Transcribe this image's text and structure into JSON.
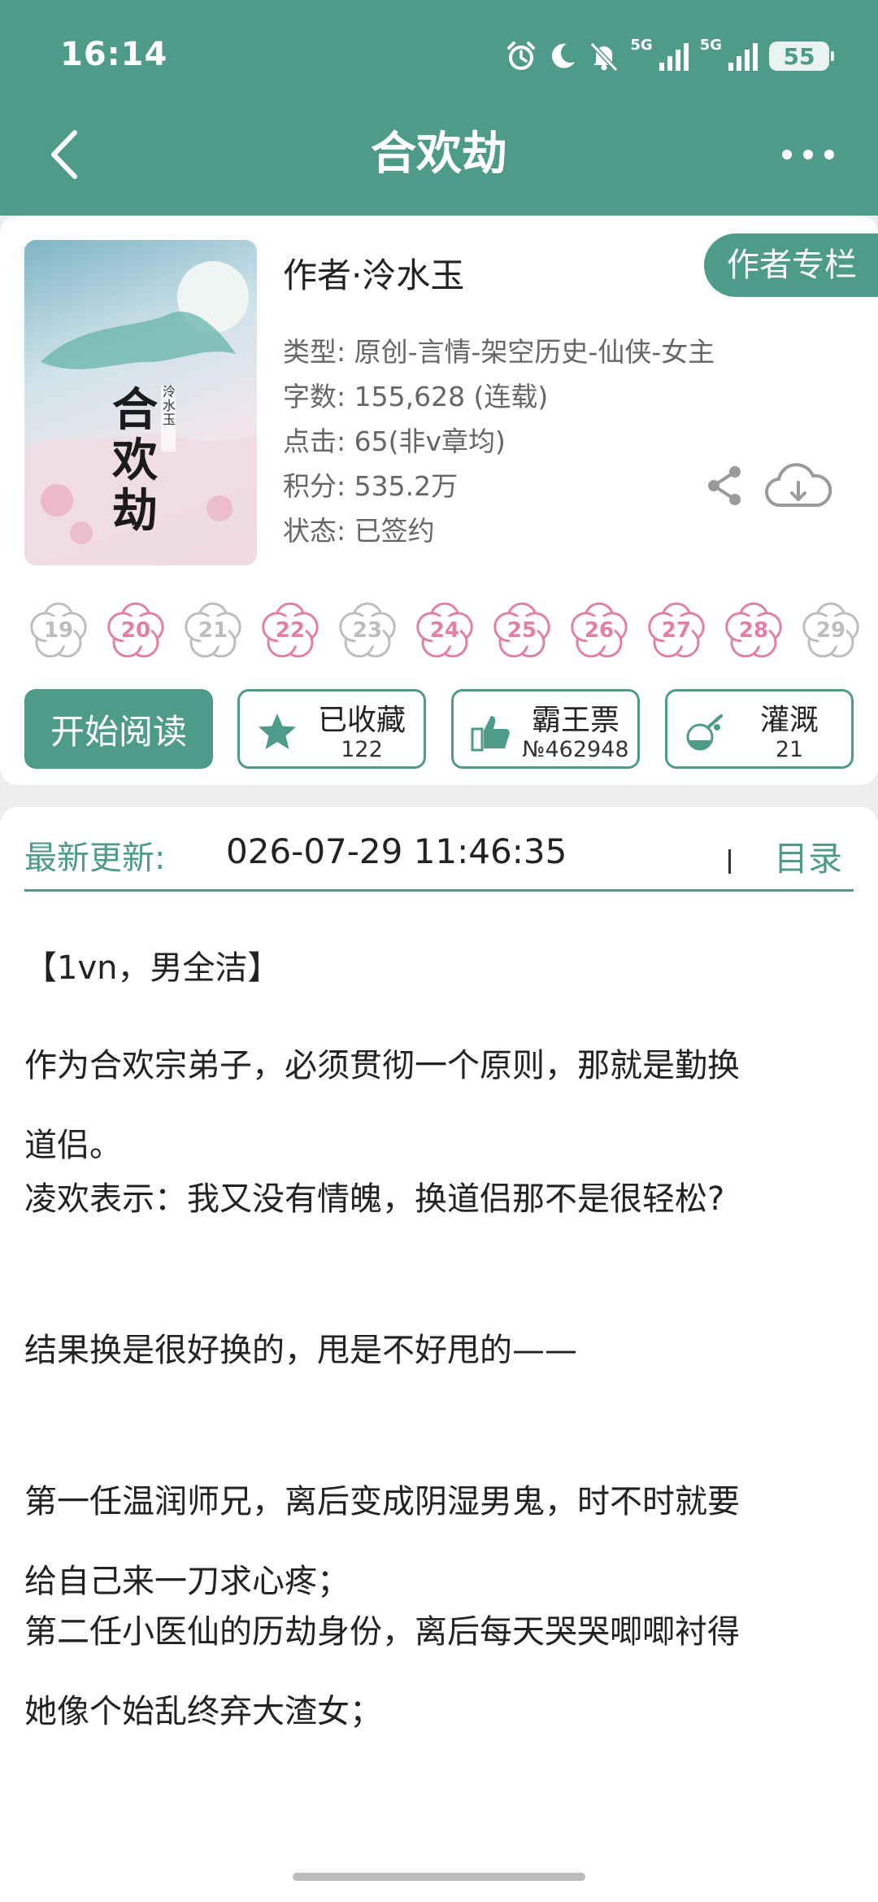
{
  "status_bar": {
    "time": "16:14",
    "signal_1_label": "5G",
    "signal_2_label": "5G",
    "battery": "55"
  },
  "nav": {
    "title": "合欢劫"
  },
  "book": {
    "author": "作者·泠水玉",
    "author_column": "作者专栏",
    "cover_author": "泠水玉",
    "cover_title": "合欢劫",
    "genre": "类型: 原创-言情-架空历史-仙侠-女主",
    "words": "字数: 155,628 (连载)",
    "clicks": "点击: 65(非v章均)",
    "points": "积分: 535.2万",
    "status": "状态: 已签约"
  },
  "flowers": [
    {
      "day": "19",
      "active": false
    },
    {
      "day": "20",
      "active": true
    },
    {
      "day": "21",
      "active": false
    },
    {
      "day": "22",
      "active": true
    },
    {
      "day": "23",
      "active": false
    },
    {
      "day": "24",
      "active": true
    },
    {
      "day": "25",
      "active": true
    },
    {
      "day": "26",
      "active": true
    },
    {
      "day": "27",
      "active": true
    },
    {
      "day": "28",
      "active": true
    },
    {
      "day": "29",
      "active": false
    }
  ],
  "actions": {
    "read": "开始阅读",
    "favorite_label": "已收藏",
    "favorite_count": "122",
    "ticket_label": "霸王票",
    "ticket_count": "№462948",
    "water_label": "灌溉",
    "water_count": "21"
  },
  "update": {
    "label": "最新更新:",
    "time": "026-07-29 11:46:35",
    "toc": "目录"
  },
  "summary": [
    "【1vn，男全洁】",
    "作为合欢宗弟子，必须贯彻一个原则，那就是勤换",
    "道侣。",
    "凌欢表示：我又没有情魄，换道侣那不是很轻松?",
    "结果换是很好换的，甩是不好甩的——",
    "第一任温润师兄，离后变成阴湿男鬼，时不时就要",
    "给自己来一刀求心疼；",
    "第二任小医仙的历劫身份，离后每天哭哭唧唧衬得",
    "她像个始乱终弃大渣女；"
  ],
  "colors": {
    "accent": "#4f9b8a",
    "flower_active": "#e37fa6",
    "flower_inactive": "#bdbdbd"
  }
}
